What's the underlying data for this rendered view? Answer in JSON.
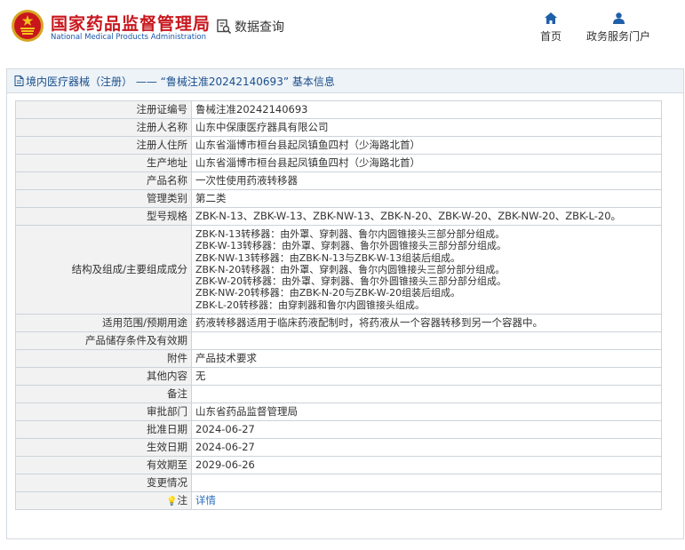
{
  "header": {
    "site_title_cn": "国家药品监督管理局",
    "site_title_en": "National Medical Products Administration",
    "query_label": "数据查询",
    "nav": [
      {
        "label": "首页",
        "icon": "home-icon"
      },
      {
        "label": "政务服务门户",
        "icon": "user-icon"
      }
    ]
  },
  "panel": {
    "title": "境内医疗器械（注册） —— “鲁械注准20242140693” 基本信息"
  },
  "rows": [
    {
      "label": "注册证编号",
      "value": "鲁械注准20242140693"
    },
    {
      "label": "注册人名称",
      "value": "山东中保康医疗器具有限公司"
    },
    {
      "label": "注册人住所",
      "value": "山东省淄博市桓台县起凤镇鱼四村（少海路北首）"
    },
    {
      "label": "生产地址",
      "value": "山东省淄博市桓台县起凤镇鱼四村（少海路北首）"
    },
    {
      "label": "产品名称",
      "value": "一次性使用药液转移器"
    },
    {
      "label": "管理类别",
      "value": "第二类"
    },
    {
      "label": "型号规格",
      "value": "ZBK-N-13、ZBK-W-13、ZBK-NW-13、ZBK-N-20、ZBK-W-20、ZBK-NW-20、ZBK-L-20。"
    },
    {
      "label": "结构及组成/主要组成成分",
      "lines": [
        "ZBK-N-13转移器：由外罩、穿刺器、鲁尔内圆锥接头三部分部分组成。",
        "ZBK-W-13转移器：由外罩、穿刺器、鲁尔外圆锥接头三部分部分组成。",
        "ZBK-NW-13转移器：由ZBK-N-13与ZBK-W-13组装后组成。",
        "ZBK-N-20转移器：由外罩、穿刺器、鲁尔内圆锥接头三部分部分组成。",
        "ZBK-W-20转移器：由外罩、穿刺器、鲁尔外圆锥接头三部分部分组成。",
        "ZBK-NW-20转移器：由ZBK-N-20与ZBK-W-20组装后组成。",
        "ZBK-L-20转移器：由穿刺器和鲁尔内圆锥接头组成。"
      ]
    },
    {
      "label": "适用范围/预期用途",
      "value": "药液转移器适用于临床药液配制时，将药液从一个容器转移到另一个容器中。"
    },
    {
      "label": "产品储存条件及有效期",
      "value": ""
    },
    {
      "label": "附件",
      "value": "产品技术要求"
    },
    {
      "label": "其他内容",
      "value": "无"
    },
    {
      "label": "备注",
      "value": ""
    },
    {
      "label": "审批部门",
      "value": "山东省药品监督管理局"
    },
    {
      "label": "批准日期",
      "value": "2024-06-27"
    },
    {
      "label": "生效日期",
      "value": "2024-06-27"
    },
    {
      "label": "有效期至",
      "value": "2029-06-26"
    },
    {
      "label": "变更情况",
      "value": ""
    },
    {
      "label": "注",
      "value": "详情",
      "icon": "bulb-icon",
      "link": true
    }
  ]
}
